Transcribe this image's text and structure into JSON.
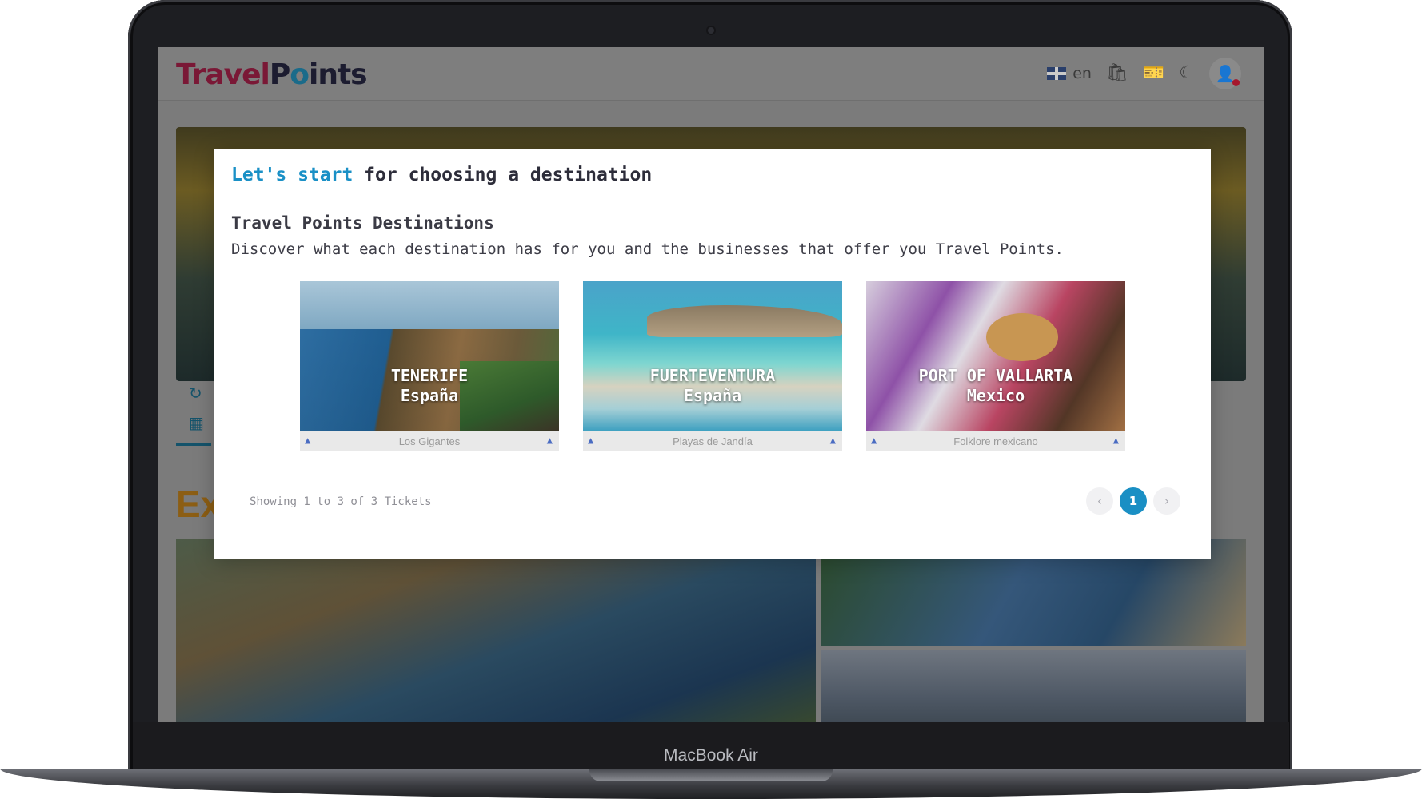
{
  "header": {
    "logo_text_1": "Travel",
    "logo_text_2": "P",
    "logo_text_3": "o",
    "logo_text_4": "ints",
    "language": "en",
    "icons": [
      "flag-uk-icon",
      "shopping-bag-icon",
      "tickets-icon",
      "moon-icon",
      "user-icon"
    ]
  },
  "background": {
    "heading_fragment": "Ex"
  },
  "modal": {
    "title_accent": "Let's start",
    "title_rest": " for choosing a destination",
    "section_title": "Travel Points Destinations",
    "section_desc": "Discover what each destination has for you and the businesses that offer you Travel Points.",
    "cards": [
      {
        "name": "TENERIFE",
        "country": "España",
        "caption": "Los Gigantes"
      },
      {
        "name": "FUERTEVENTURA",
        "country": "España",
        "caption": "Playas de Jandía"
      },
      {
        "name": "PORT OF VALLARTA",
        "country": "Mexico",
        "caption": "Folklore mexicano"
      }
    ],
    "showing_text": "Showing 1 to 3 of 3 Tickets",
    "pagination": {
      "prev": "‹",
      "current": "1",
      "next": "›"
    }
  },
  "device": {
    "model_label": "MacBook Air"
  },
  "colors": {
    "accent": "#1a90c6",
    "page_active": "#1a8fc4"
  }
}
